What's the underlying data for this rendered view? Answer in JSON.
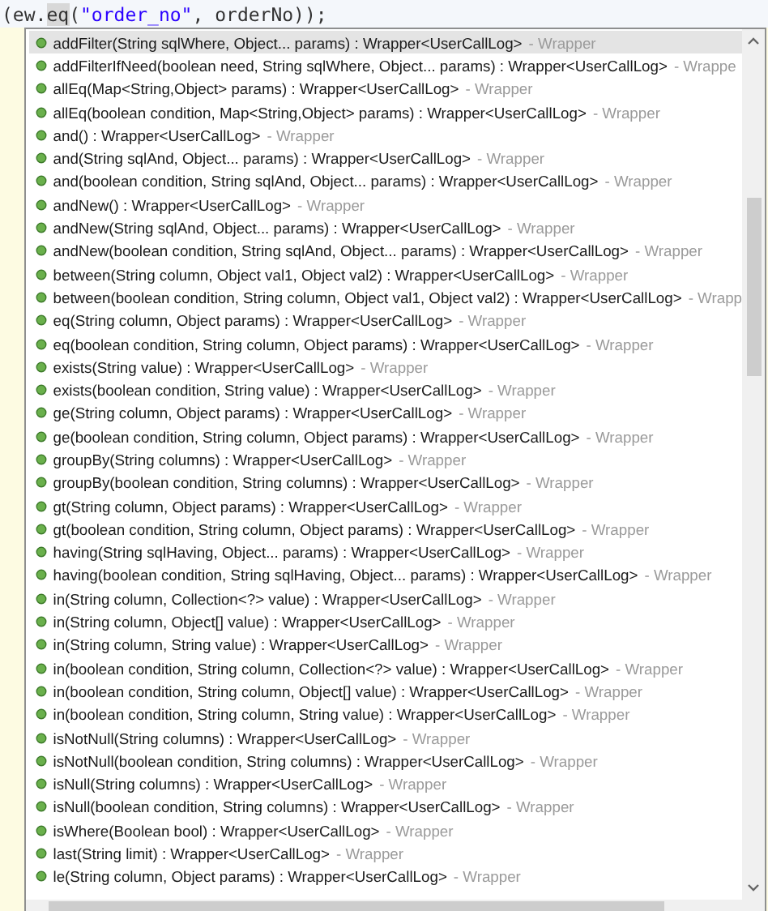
{
  "editor_line": {
    "tokens": [
      {
        "text": "(ew.",
        "kind": "plain"
      },
      {
        "text": "eq",
        "kind": "match"
      },
      {
        "text": "(",
        "kind": "plain"
      },
      {
        "text": "\"order_no\"",
        "kind": "string"
      },
      {
        "text": ", orderNo));",
        "kind": "plain"
      }
    ]
  },
  "completion_list": {
    "items": [
      {
        "signature": "addFilter(String sqlWhere, Object... params) : Wrapper<UserCallLog>",
        "owner": "- Wrapper",
        "selected": true
      },
      {
        "signature": "addFilterIfNeed(boolean need, String sqlWhere, Object... params) : Wrapper<UserCallLog>",
        "owner": "- Wrappe",
        "selected": false
      },
      {
        "signature": "allEq(Map<String,Object> params) : Wrapper<UserCallLog>",
        "owner": "- Wrapper",
        "selected": false
      },
      {
        "signature": "allEq(boolean condition, Map<String,Object> params) : Wrapper<UserCallLog>",
        "owner": "- Wrapper",
        "selected": false
      },
      {
        "signature": "and() : Wrapper<UserCallLog>",
        "owner": "- Wrapper",
        "selected": false
      },
      {
        "signature": "and(String sqlAnd, Object... params) : Wrapper<UserCallLog>",
        "owner": "- Wrapper",
        "selected": false
      },
      {
        "signature": "and(boolean condition, String sqlAnd, Object... params) : Wrapper<UserCallLog>",
        "owner": "- Wrapper",
        "selected": false
      },
      {
        "signature": "andNew() : Wrapper<UserCallLog>",
        "owner": "- Wrapper",
        "selected": false
      },
      {
        "signature": "andNew(String sqlAnd, Object... params) : Wrapper<UserCallLog>",
        "owner": "- Wrapper",
        "selected": false
      },
      {
        "signature": "andNew(boolean condition, String sqlAnd, Object... params) : Wrapper<UserCallLog>",
        "owner": "- Wrapper",
        "selected": false
      },
      {
        "signature": "between(String column, Object val1, Object val2) : Wrapper<UserCallLog>",
        "owner": "- Wrapper",
        "selected": false
      },
      {
        "signature": "between(boolean condition, String column, Object val1, Object val2) : Wrapper<UserCallLog>",
        "owner": "- Wrapp",
        "selected": false
      },
      {
        "signature": "eq(String column, Object params) : Wrapper<UserCallLog>",
        "owner": "- Wrapper",
        "selected": false
      },
      {
        "signature": "eq(boolean condition, String column, Object params) : Wrapper<UserCallLog>",
        "owner": "- Wrapper",
        "selected": false
      },
      {
        "signature": "exists(String value) : Wrapper<UserCallLog>",
        "owner": "- Wrapper",
        "selected": false
      },
      {
        "signature": "exists(boolean condition, String value) : Wrapper<UserCallLog>",
        "owner": "- Wrapper",
        "selected": false
      },
      {
        "signature": "ge(String column, Object params) : Wrapper<UserCallLog>",
        "owner": "- Wrapper",
        "selected": false
      },
      {
        "signature": "ge(boolean condition, String column, Object params) : Wrapper<UserCallLog>",
        "owner": "- Wrapper",
        "selected": false
      },
      {
        "signature": "groupBy(String columns) : Wrapper<UserCallLog>",
        "owner": "- Wrapper",
        "selected": false
      },
      {
        "signature": "groupBy(boolean condition, String columns) : Wrapper<UserCallLog>",
        "owner": "- Wrapper",
        "selected": false
      },
      {
        "signature": "gt(String column, Object params) : Wrapper<UserCallLog>",
        "owner": "- Wrapper",
        "selected": false
      },
      {
        "signature": "gt(boolean condition, String column, Object params) : Wrapper<UserCallLog>",
        "owner": "- Wrapper",
        "selected": false
      },
      {
        "signature": "having(String sqlHaving, Object... params) : Wrapper<UserCallLog>",
        "owner": "- Wrapper",
        "selected": false
      },
      {
        "signature": "having(boolean condition, String sqlHaving, Object... params) : Wrapper<UserCallLog>",
        "owner": "- Wrapper",
        "selected": false
      },
      {
        "signature": "in(String column, Collection<?> value) : Wrapper<UserCallLog>",
        "owner": "- Wrapper",
        "selected": false
      },
      {
        "signature": "in(String column, Object[] value) : Wrapper<UserCallLog>",
        "owner": "- Wrapper",
        "selected": false
      },
      {
        "signature": "in(String column, String value) : Wrapper<UserCallLog>",
        "owner": "- Wrapper",
        "selected": false
      },
      {
        "signature": "in(boolean condition, String column, Collection<?> value) : Wrapper<UserCallLog>",
        "owner": "- Wrapper",
        "selected": false
      },
      {
        "signature": "in(boolean condition, String column, Object[] value) : Wrapper<UserCallLog>",
        "owner": "- Wrapper",
        "selected": false
      },
      {
        "signature": "in(boolean condition, String column, String value) : Wrapper<UserCallLog>",
        "owner": "- Wrapper",
        "selected": false
      },
      {
        "signature": "isNotNull(String columns) : Wrapper<UserCallLog>",
        "owner": "- Wrapper",
        "selected": false
      },
      {
        "signature": "isNotNull(boolean condition, String columns) : Wrapper<UserCallLog>",
        "owner": "- Wrapper",
        "selected": false
      },
      {
        "signature": "isNull(String columns) : Wrapper<UserCallLog>",
        "owner": "- Wrapper",
        "selected": false
      },
      {
        "signature": "isNull(boolean condition, String columns) : Wrapper<UserCallLog>",
        "owner": "- Wrapper",
        "selected": false
      },
      {
        "signature": "isWhere(Boolean bool) : Wrapper<UserCallLog>",
        "owner": "- Wrapper",
        "selected": false
      },
      {
        "signature": "last(String limit) : Wrapper<UserCallLog>",
        "owner": "- Wrapper",
        "selected": false
      },
      {
        "signature": "le(String column, Object params) : Wrapper<UserCallLog>",
        "owner": "- Wrapper",
        "selected": false
      }
    ]
  }
}
